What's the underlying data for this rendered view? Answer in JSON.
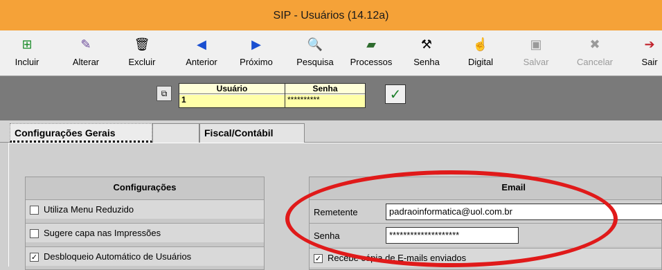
{
  "window": {
    "title": "SIP - Usuários  (14.12a)"
  },
  "toolbar": {
    "incluir": "Incluir",
    "alterar": "Alterar",
    "excluir": "Excluir",
    "anterior": "Anterior",
    "proximo": "Próximo",
    "pesquisa": "Pesquisa",
    "processos": "Processos",
    "senha": "Senha",
    "digital": "Digital",
    "salvar": "Salvar",
    "cancelar": "Cancelar",
    "sair": "Sair"
  },
  "icons": {
    "incluir": "plus-page-icon",
    "alterar": "edit-icon",
    "excluir": "trash-icon",
    "anterior": "arrow-left-icon",
    "proximo": "arrow-right-icon",
    "pesquisa": "search-icon",
    "processos": "book-icon",
    "senha": "tools-icon",
    "digital": "hand-pointer-icon",
    "salvar": "disk-icon",
    "cancelar": "x-icon",
    "sair": "exit-door-icon"
  },
  "user_grid": {
    "col_usuario": "Usuário",
    "col_senha": "Senha",
    "usuario_value": "1",
    "senha_value": "**********"
  },
  "tabs": {
    "config_gerais": "Configurações Gerais",
    "fiscal": "Fiscal/Contábil"
  },
  "configuracoes": {
    "title": "Configurações",
    "items": [
      {
        "label": "Utiliza Menu Reduzido",
        "checked": false
      },
      {
        "label": "Sugere capa nas Impressões",
        "checked": false
      },
      {
        "label": "Desbloqueio Automático de Usuários",
        "checked": true
      }
    ]
  },
  "email": {
    "title": "Email",
    "remetente_label": "Remetente",
    "remetente_value": "padraoinformatica@uol.com.br",
    "senha_label": "Senha",
    "senha_value": "********************",
    "copia_label": "Recebe cópia de E-mails enviados",
    "copia_checked": true
  },
  "colors": {
    "title_bar": "#f5a238",
    "highlight_ellipse": "#e01a1a",
    "grid_cell": "#ffffa8"
  }
}
